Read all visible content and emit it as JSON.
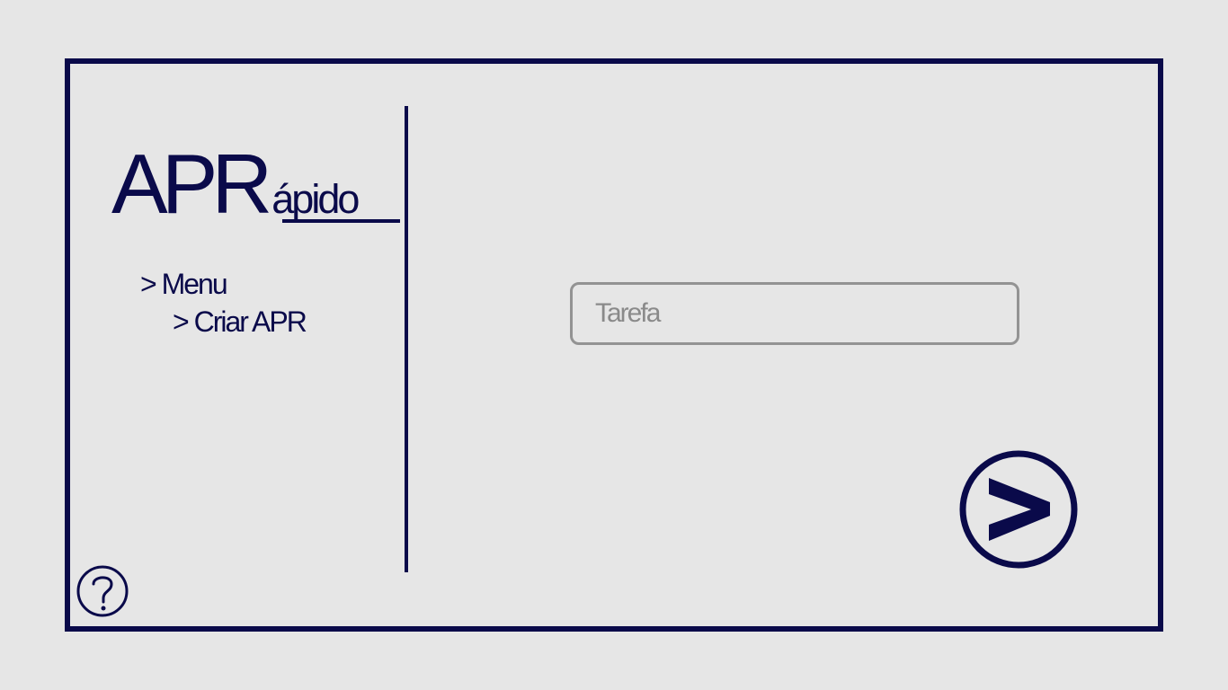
{
  "app": {
    "logo_main": "APR",
    "logo_sub": "ápido"
  },
  "breadcrumb": {
    "menu_label": "> Menu",
    "current_label": "> Criar APR"
  },
  "form": {
    "task_placeholder": "Tarefa",
    "task_value": ""
  },
  "actions": {
    "next_icon": "chevron-right-circle-icon",
    "help_icon": "question-circle-icon"
  },
  "colors": {
    "accent": "#0a0a4a",
    "background": "#e6e6e6",
    "input_border": "#939393",
    "placeholder": "#8a8a8a"
  }
}
